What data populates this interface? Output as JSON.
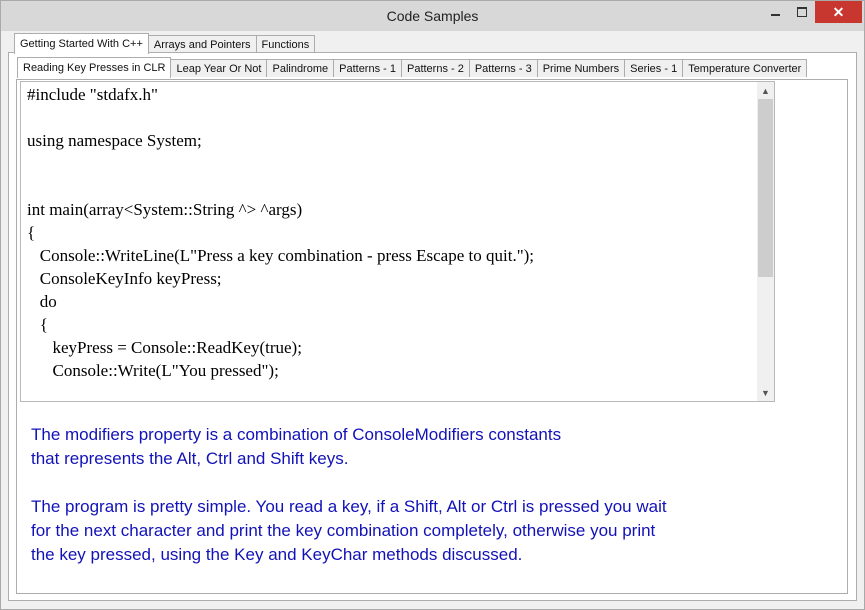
{
  "window": {
    "title": "Code Samples",
    "minimize": "minimize",
    "maximize": "maximize",
    "close": "close"
  },
  "outer_tabs": [
    {
      "label": "Getting Started With C++",
      "active": true
    },
    {
      "label": "Arrays and Pointers",
      "active": false
    },
    {
      "label": "Functions",
      "active": false
    }
  ],
  "inner_tabs": [
    {
      "label": "Reading Key Presses in CLR",
      "active": true
    },
    {
      "label": "Leap Year Or Not",
      "active": false
    },
    {
      "label": "Palindrome",
      "active": false
    },
    {
      "label": "Patterns - 1",
      "active": false
    },
    {
      "label": "Patterns - 2",
      "active": false
    },
    {
      "label": "Patterns - 3",
      "active": false
    },
    {
      "label": "Prime Numbers",
      "active": false
    },
    {
      "label": "Series - 1",
      "active": false
    },
    {
      "label": "Temperature Converter",
      "active": false
    }
  ],
  "code": "#include \"stdafx.h\"\n\nusing namespace System;\n\n\nint main(array<System::String ^> ^args)\n{\n\tConsole::WriteLine(L\"Press a key combination - press Escape to quit.\");\n\tConsoleKeyInfo keyPress;\n\tdo\n\t{\n\t\tkeyPress = Console::ReadKey(true);\n\t\tConsole::Write(L\"You pressed\");",
  "description": {
    "paragraph1": "The modifiers property is a combination of ConsoleModifiers constants\nthat represents the Alt, Ctrl and Shift keys.",
    "paragraph2": "The program is pretty simple. You read a key, if a Shift, Alt or Ctrl is pressed you wait\nfor the next character and print the key combination completely, otherwise you print\nthe key pressed, using the Key and KeyChar methods discussed."
  },
  "colors": {
    "description_text": "#1212b8",
    "close_button": "#c7372f"
  }
}
